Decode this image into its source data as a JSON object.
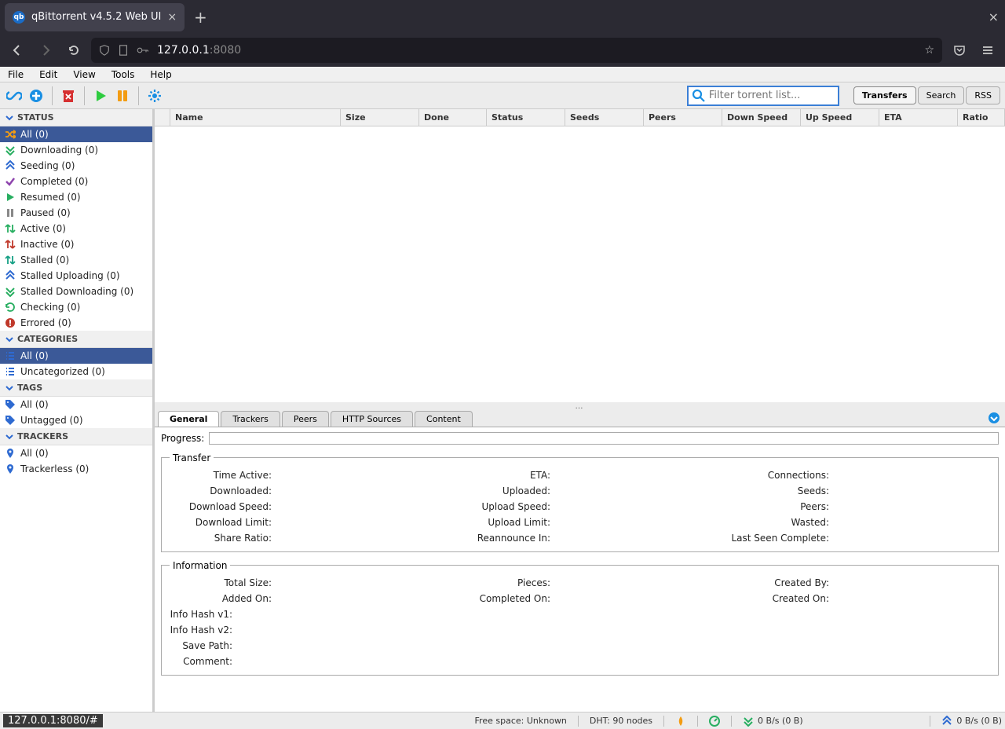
{
  "browser": {
    "tab_title": "qBittorrent v4.5.2 Web UI",
    "url_host": "127.0.0.1",
    "url_port": ":8080"
  },
  "menubar": [
    "File",
    "Edit",
    "View",
    "Tools",
    "Help"
  ],
  "toolbar": {
    "search_placeholder": "Filter torrent list...",
    "view_tabs": [
      "Transfers",
      "Search",
      "RSS"
    ]
  },
  "sidebar": {
    "sections": [
      {
        "title": "STATUS",
        "items": [
          {
            "label": "All (0)",
            "icon": "shuffle",
            "color": "#f39c12",
            "selected": true
          },
          {
            "label": "Downloading (0)",
            "icon": "down-chev",
            "color": "#27ae60"
          },
          {
            "label": "Seeding (0)",
            "icon": "up-chev",
            "color": "#2e6ad1"
          },
          {
            "label": "Completed (0)",
            "icon": "check",
            "color": "#8e44ad"
          },
          {
            "label": "Resumed (0)",
            "icon": "play",
            "color": "#27ae60"
          },
          {
            "label": "Paused (0)",
            "icon": "pause",
            "color": "#888"
          },
          {
            "label": "Active (0)",
            "icon": "updown",
            "color": "#27ae60"
          },
          {
            "label": "Inactive (0)",
            "icon": "updown",
            "color": "#c0392b"
          },
          {
            "label": "Stalled (0)",
            "icon": "updown",
            "color": "#16a085"
          },
          {
            "label": "Stalled Uploading (0)",
            "icon": "up-chev",
            "color": "#2e6ad1"
          },
          {
            "label": "Stalled Downloading (0)",
            "icon": "down-chev",
            "color": "#27ae60"
          },
          {
            "label": "Checking (0)",
            "icon": "refresh",
            "color": "#27ae60"
          },
          {
            "label": "Errored (0)",
            "icon": "error",
            "color": "#c0392b"
          }
        ]
      },
      {
        "title": "CATEGORIES",
        "items": [
          {
            "label": "All (0)",
            "icon": "list",
            "color": "#2e6ad1",
            "selected": true
          },
          {
            "label": "Uncategorized (0)",
            "icon": "list",
            "color": "#2e6ad1"
          }
        ]
      },
      {
        "title": "TAGS",
        "items": [
          {
            "label": "All (0)",
            "icon": "tag",
            "color": "#2e6ad1"
          },
          {
            "label": "Untagged (0)",
            "icon": "tag",
            "color": "#2e6ad1"
          }
        ]
      },
      {
        "title": "TRACKERS",
        "items": [
          {
            "label": "All (0)",
            "icon": "pin",
            "color": "#2e6ad1"
          },
          {
            "label": "Trackerless (0)",
            "icon": "pin",
            "color": "#2e6ad1"
          }
        ]
      }
    ]
  },
  "table": {
    "columns": [
      "Name",
      "Size",
      "Done",
      "Status",
      "Seeds",
      "Peers",
      "Down Speed",
      "Up Speed",
      "ETA",
      "Ratio"
    ]
  },
  "detail": {
    "tabs": [
      "General",
      "Trackers",
      "Peers",
      "HTTP Sources",
      "Content"
    ],
    "progress_label": "Progress:",
    "transfer": {
      "legend": "Transfer",
      "rows": [
        [
          "Time Active:",
          "ETA:",
          "Connections:"
        ],
        [
          "Downloaded:",
          "Uploaded:",
          "Seeds:"
        ],
        [
          "Download Speed:",
          "Upload Speed:",
          "Peers:"
        ],
        [
          "Download Limit:",
          "Upload Limit:",
          "Wasted:"
        ],
        [
          "Share Ratio:",
          "Reannounce In:",
          "Last Seen Complete:"
        ]
      ]
    },
    "information": {
      "legend": "Information",
      "rows3": [
        [
          "Total Size:",
          "Pieces:",
          "Created By:"
        ],
        [
          "Added On:",
          "Completed On:",
          "Created On:"
        ]
      ],
      "rows1": [
        "Info Hash v1:",
        "Info Hash v2:",
        "Save Path:",
        "Comment:"
      ]
    }
  },
  "statusbar": {
    "hover_url": "127.0.0.1:8080/#",
    "free_space": "Free space: Unknown",
    "dht": "DHT: 90 nodes",
    "down": "0 B/s (0 B)",
    "up": "0 B/s (0 B)"
  }
}
